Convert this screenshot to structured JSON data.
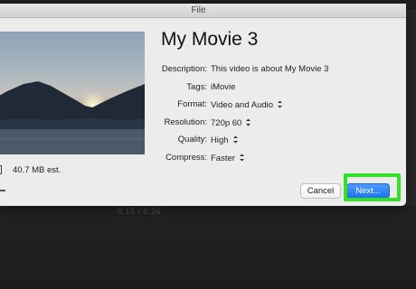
{
  "window": {
    "title": "File"
  },
  "movie": {
    "title": "My Movie 3"
  },
  "fields": {
    "description": {
      "label": "Description:",
      "value": "This video is about My Movie 3"
    },
    "tags": {
      "label": "Tags:",
      "value": "iMovie"
    },
    "format": {
      "label": "Format:",
      "value": "Video and Audio"
    },
    "resolution": {
      "label": "Resolution:",
      "value": "720p 60"
    },
    "quality": {
      "label": "Quality:",
      "value": "High"
    },
    "compress": {
      "label": "Compress:",
      "value": "Faster"
    }
  },
  "size_estimate": "40.7 MB est.",
  "buttons": {
    "cancel": "Cancel",
    "next": "Next..."
  },
  "playback": {
    "timecode": "0:15  /  0:26"
  },
  "colors": {
    "highlight": "#33e226",
    "primary_button": "#2a7cf6"
  },
  "icons": [
    "stepper-icon",
    "file-size-icon"
  ]
}
